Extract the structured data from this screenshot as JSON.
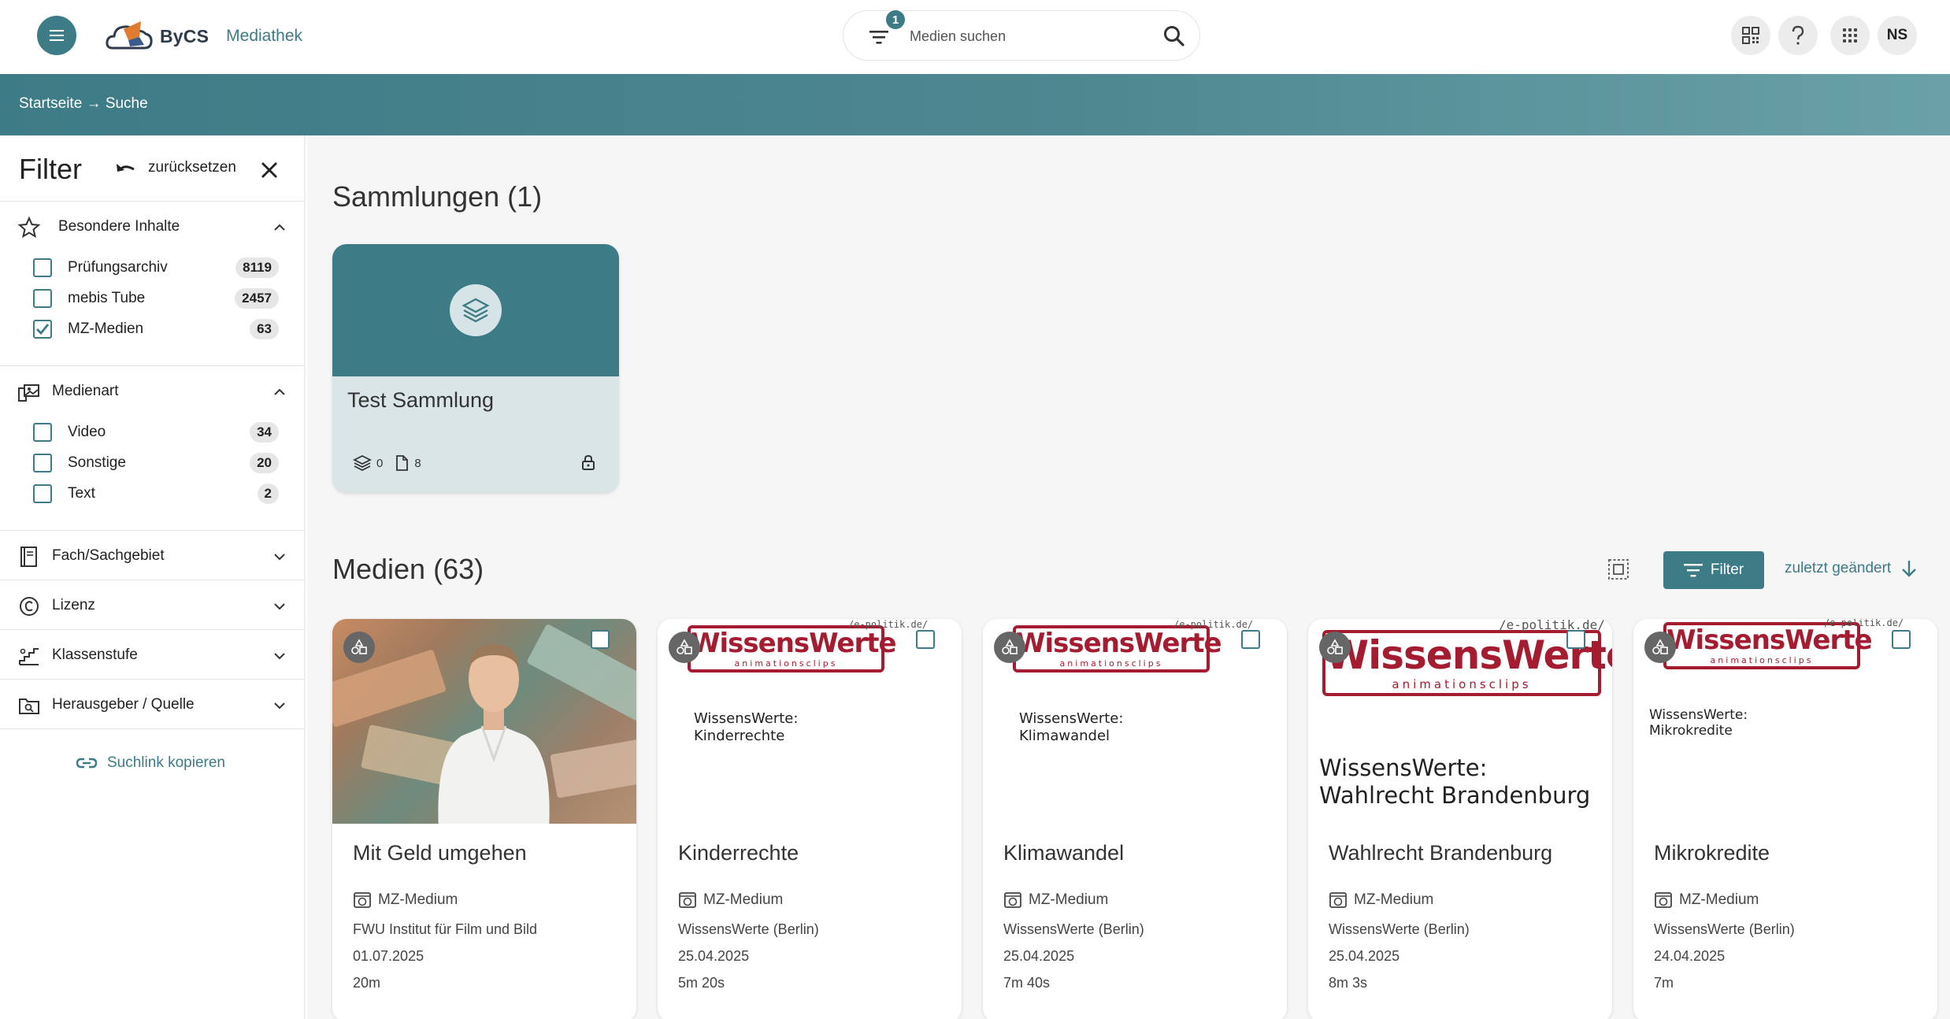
{
  "header": {
    "logo_text": "ByCS",
    "app_name": "Mediathek",
    "search": {
      "placeholder": "Medien suchen",
      "filter_count": "1"
    },
    "avatar_initials": "NS"
  },
  "breadcrumb": "Startseite → Suche",
  "sidebar": {
    "title": "Filter",
    "reset_label": "zurücksetzen",
    "sections": [
      {
        "label": "Besondere Inhalte",
        "expanded": true,
        "options": [
          {
            "label": "Prüfungsarchiv",
            "count": "8119",
            "checked": false
          },
          {
            "label": "mebis Tube",
            "count": "2457",
            "checked": false
          },
          {
            "label": "MZ-Medien",
            "count": "63",
            "checked": true
          }
        ]
      },
      {
        "label": "Medienart",
        "expanded": true,
        "options": [
          {
            "label": "Video",
            "count": "34",
            "checked": false
          },
          {
            "label": "Sonstige",
            "count": "20",
            "checked": false
          },
          {
            "label": "Text",
            "count": "2",
            "checked": false
          }
        ]
      },
      {
        "label": "Fach/Sachgebiet",
        "expanded": false
      },
      {
        "label": "Lizenz",
        "expanded": false
      },
      {
        "label": "Klassenstufe",
        "expanded": false
      },
      {
        "label": "Herausgeber / Quelle",
        "expanded": false
      }
    ],
    "copy_link_label": "Suchlink kopieren"
  },
  "main": {
    "collections_heading": "Sammlungen (1)",
    "collection": {
      "title": "Test Sammlung",
      "collections_count": "0",
      "media_count": "8"
    },
    "media_heading": "Medien (63)",
    "filter_button": "Filter",
    "sort_label": "zuletzt geändert",
    "cards": [
      {
        "title": "Mit Geld umgehen",
        "type": "MZ-Medium",
        "publisher": "FWU Institut für Film und Bild",
        "date": "01.07.2025",
        "duration": "20m",
        "thumb_text": ""
      },
      {
        "title": "Kinderrechte",
        "type": "MZ-Medium",
        "publisher": "WissensWerte (Berlin)",
        "date": "25.04.2025",
        "duration": "5m 20s",
        "thumb_text": "WissensWerte:\nKinderrechte"
      },
      {
        "title": "Klimawandel",
        "type": "MZ-Medium",
        "publisher": "WissensWerte (Berlin)",
        "date": "25.04.2025",
        "duration": "7m 40s",
        "thumb_text": "WissensWerte:\nKlimawandel"
      },
      {
        "title": "Wahlrecht Brandenburg",
        "type": "MZ-Medium",
        "publisher": "WissensWerte (Berlin)",
        "date": "25.04.2025",
        "duration": "8m 3s",
        "thumb_text": "WissensWerte:\nWahlrecht Brandenburg"
      },
      {
        "title": "Mikrokredite",
        "type": "MZ-Medium",
        "publisher": "WissensWerte (Berlin)",
        "date": "24.04.2025",
        "duration": "7m",
        "thumb_text": "WissensWerte:\nMikrokredite"
      }
    ],
    "thumb_logo": {
      "main": "WissensWerte",
      "sub": "animationsclips",
      "url": "/e-politik.de/"
    }
  },
  "colors": {
    "primary": "#3d7b86",
    "logo_red": "#a51c30"
  }
}
